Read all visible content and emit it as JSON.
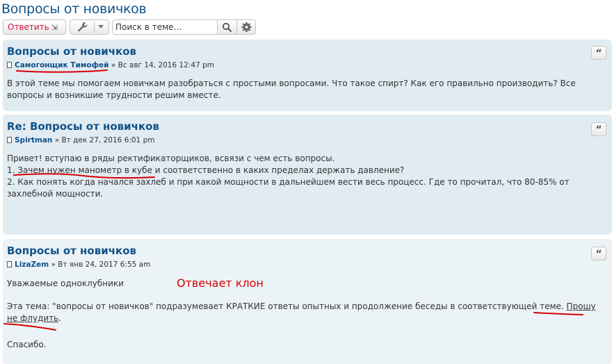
{
  "topic_title": "Вопросы от новичков",
  "toolbar": {
    "reply_label": "Ответить",
    "reply_arrow": "⇲",
    "search_placeholder": "Поиск в теме…"
  },
  "posts": [
    {
      "title": "Вопросы от новичков",
      "author": "Самогонщик Тимофей",
      "date": "» Вс авг 14, 2016 12:47 pm",
      "body": "В этой теме мы помогаем новичкам разобраться с простыми вопросами. Что такое спирт? Как его правильно производить? Все вопросы и возникшие трудности решим вместе."
    },
    {
      "title": "Re: Вопросы от новичков",
      "author": "Spirtman",
      "date": "» Вт дек 27, 2016 6:01 pm",
      "line1": "Привет! вступаю в ряды ректификаторщиков, всвязи с чем есть вопросы.",
      "line2": "1. Зачем нужен манометр в кубе и соответственно в каких пределах держать давление?",
      "line3": "2. Как понять когда начался захлеб и при какой мощности в дальнейшем вести весь процесс. Где то прочитал, что 80-85% от захлебной мощности."
    },
    {
      "title": "Вопросы от новичков",
      "author": "LizaZem",
      "date": "» Вт янв 24, 2017 6:55 am",
      "greeting": "Уважаемые одноклубники",
      "para_main": "Эта тема: \"вопросы от новичков\" подразумевает КРАТКИЕ ответы опытных и продолжение беседы в соответствующей теме. ",
      "para_link": "Прошу не флудить",
      "para_end": ".",
      "thanks": "Спасибо."
    }
  ],
  "annotation": "Отвечает клон",
  "colors": {
    "link": "#105289",
    "post_bg": "#e1ebf2",
    "post_bg_alt": "#ecf3f7",
    "reply": "#d31141",
    "mark": "#d40000"
  },
  "icons": [
    "wrench-icon",
    "chevron-down-icon",
    "search-icon",
    "gear-icon",
    "post-icon",
    "quote-icon"
  ]
}
